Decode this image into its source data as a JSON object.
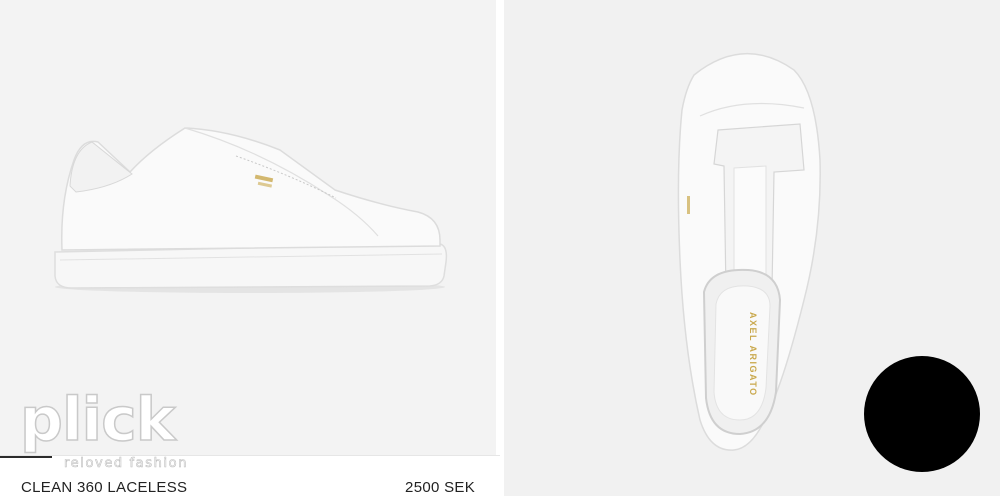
{
  "brand": {
    "logo_word": "plick",
    "logo_tagline": "reloved fashion"
  },
  "product": {
    "name": "CLEAN 360 LACELESS",
    "price": "2500 SEK",
    "insole_brand": "AXEL ARIGATO"
  },
  "colors": {
    "panel_bg": "#f3f3f3",
    "shoe_white": "#fafafa",
    "gold_logo": "#c9a84c",
    "circle": "#000000"
  },
  "icons": {
    "action_button": "black-circle-button"
  }
}
